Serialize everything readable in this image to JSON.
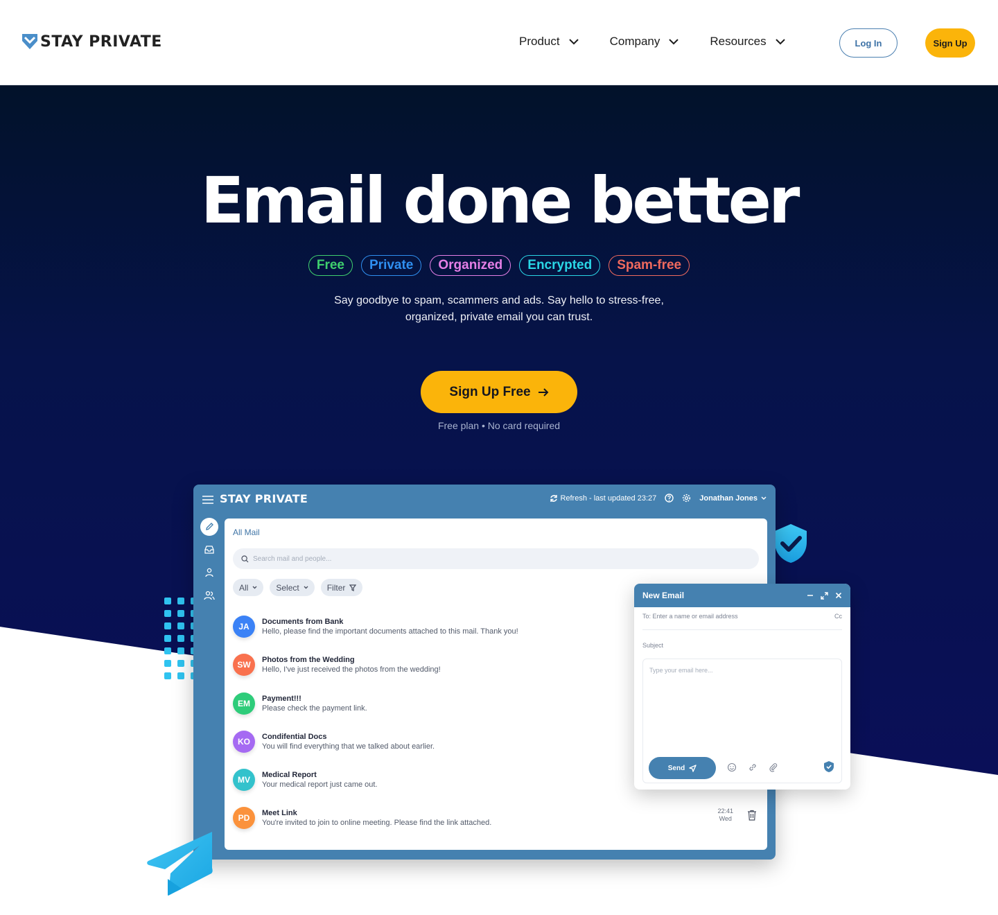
{
  "header": {
    "logo_text": "STAY PRIVATE",
    "nav": [
      {
        "label": "Product"
      },
      {
        "label": "Company"
      },
      {
        "label": "Resources"
      }
    ],
    "login_label": "Log In",
    "signup_label": "Sign Up"
  },
  "hero": {
    "title": "Email done better",
    "tags": [
      {
        "label": "Free",
        "color": "#3fcf6e"
      },
      {
        "label": "Private",
        "color": "#2f8ff0"
      },
      {
        "label": "Organized",
        "color": "#e57fe6"
      },
      {
        "label": "Encrypted",
        "color": "#2ad6e6"
      },
      {
        "label": "Spam-free",
        "color": "#f06a5e"
      }
    ],
    "subtitle": "Say goodbye to spam, scammers and ads. Say hello to stress-free, organized, private email you can trust.",
    "cta_label": "Sign Up Free",
    "cta_icon": "arrow-right-icon",
    "cta_note": "Free plan • No card required"
  },
  "app": {
    "title": "STAY PRIVATE",
    "refresh_text": "Refresh - last updated 23:27",
    "user_name": "Jonathan Jones",
    "sidebar_icons": [
      "pencil-icon",
      "inbox-icon",
      "user-icon",
      "users-icon"
    ],
    "breadcrumb": "All Mail",
    "search_placeholder": "Search mail and people...",
    "filters": [
      {
        "label": "All",
        "icon": "chevron-down-icon"
      },
      {
        "label": "Select",
        "icon": "chevron-down-icon"
      },
      {
        "label": "Filter",
        "icon": "funnel-icon"
      }
    ],
    "mails": [
      {
        "initials": "JA",
        "color": "#3b82f6",
        "subject": "Documents from Bank",
        "preview": "Hello, please find the important documents attached to this mail. Thank you!"
      },
      {
        "initials": "SW",
        "color": "#f9714e",
        "subject": "Photos from the Wedding",
        "preview": "Hello, I've just received the photos from the wedding!"
      },
      {
        "initials": "EM",
        "color": "#2ecc7a",
        "subject": "Payment!!!",
        "preview": "Please check the payment link."
      },
      {
        "initials": "KO",
        "color": "#a56af2",
        "subject": "Condifential Docs",
        "preview": "You will find everything that we talked about earlier."
      },
      {
        "initials": "MV",
        "color": "#33c2cc",
        "subject": "Medical Report",
        "preview": "Your medical report just came out."
      },
      {
        "initials": "PD",
        "color": "#fb923c",
        "subject": "Meet Link",
        "preview": "You're invited to join to online meeting. Please find the link attached.",
        "time": "22:41",
        "day": "Wed"
      }
    ]
  },
  "compose": {
    "title": "New Email",
    "to_placeholder": "To: Enter a name or email address",
    "cc_label": "Cc",
    "subject_placeholder": "Subject",
    "body_placeholder": "Type your email here...",
    "send_label": "Send"
  },
  "colors": {
    "accent_yellow": "#fbb40a",
    "app_blue": "#4581b0",
    "hero_dark": "#06134a"
  }
}
